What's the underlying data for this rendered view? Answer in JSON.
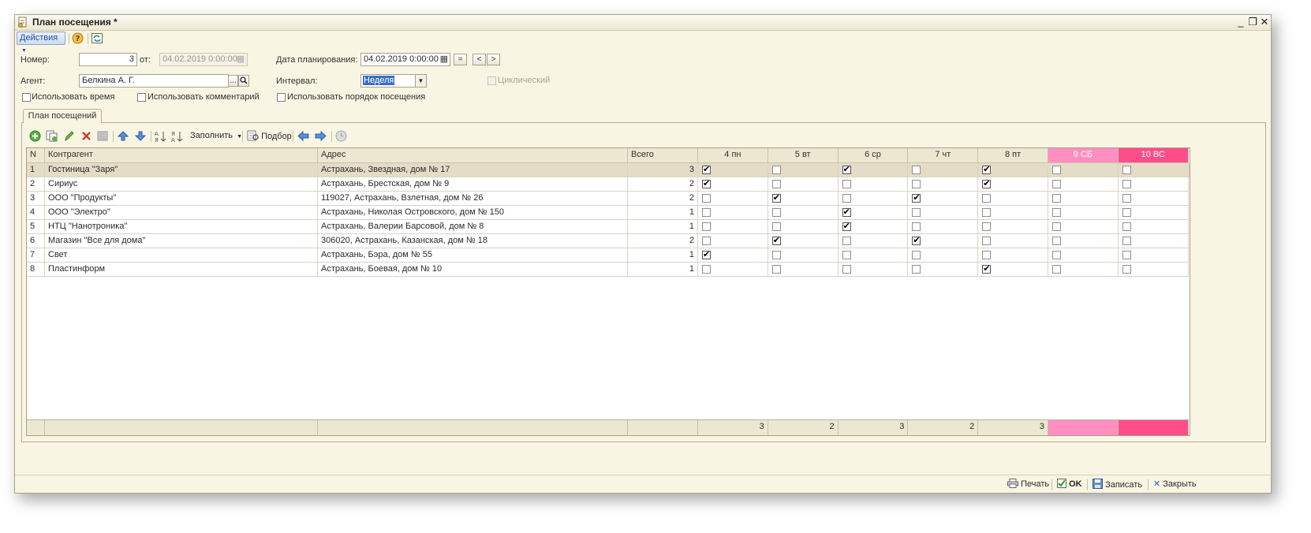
{
  "window": {
    "title": "План посещения *",
    "controls": {
      "minimize": "_",
      "restore": "❐",
      "close": "✕"
    }
  },
  "toolbar": {
    "actions_label": "Действия",
    "help_icon": "help-icon",
    "refresh_icon": "refresh-icon"
  },
  "form": {
    "number_label": "Номер:",
    "number_value": "3",
    "from_label": "от:",
    "from_value": "04.02.2019 0:00:00",
    "plan_date_label": "Дата планирования:",
    "plan_date_value": "04.02.2019 0:00:00",
    "btn_eq": "=",
    "btn_prev": "<",
    "btn_next": ">",
    "agent_label": "Агент:",
    "agent_value": "Белкина А. Г.",
    "agent_select": "...",
    "interval_label": "Интервал:",
    "interval_value": "Неделя",
    "cyclic_label": "Циклический",
    "use_time_label": "Использовать время",
    "use_comment_label": "Использовать комментарий",
    "use_order_label": "Использовать порядок посещения"
  },
  "tab": {
    "label": "План посещений"
  },
  "grid_toolbar": {
    "fill_label": "Заполнить",
    "pick_label": "Подбор"
  },
  "table": {
    "columns": {
      "n": "N",
      "counterparty": "Контрагент",
      "address": "Адрес",
      "total": "Всего",
      "days": [
        "4 пн",
        "5 вт",
        "6 ср",
        "7 чт",
        "8 пт",
        "9 СБ",
        "10 ВС"
      ]
    },
    "rows": [
      {
        "n": "1",
        "name": "Гостиница \"Заря\"",
        "address": "Астрахань, Звездная, дом № 17",
        "total": "3",
        "days": [
          true,
          false,
          true,
          false,
          true,
          false,
          false
        ]
      },
      {
        "n": "2",
        "name": "Сириус",
        "address": "Астрахань, Брестская, дом № 9",
        "total": "2",
        "days": [
          true,
          false,
          false,
          false,
          true,
          false,
          false
        ]
      },
      {
        "n": "3",
        "name": "ООО \"Продукты\"",
        "address": "119027, Астрахань, Взлетная, дом № 26",
        "total": "2",
        "days": [
          false,
          true,
          false,
          true,
          false,
          false,
          false
        ]
      },
      {
        "n": "4",
        "name": "ООО \"Электро\"",
        "address": "Астрахань, Николая Островского, дом № 150",
        "total": "1",
        "days": [
          false,
          false,
          true,
          false,
          false,
          false,
          false
        ]
      },
      {
        "n": "5",
        "name": "НТЦ \"Нанотроника\"",
        "address": "Астрахань, Валерии Барсовой, дом № 8",
        "total": "1",
        "days": [
          false,
          false,
          true,
          false,
          false,
          false,
          false
        ]
      },
      {
        "n": "6",
        "name": "Магазин \"Все для дома\"",
        "address": "306020, Астрахань, Казанская, дом № 18",
        "total": "2",
        "days": [
          false,
          true,
          false,
          true,
          false,
          false,
          false
        ]
      },
      {
        "n": "7",
        "name": "Свет",
        "address": "Астрахань, Бэра, дом № 55",
        "total": "1",
        "days": [
          true,
          false,
          false,
          false,
          false,
          false,
          false
        ]
      },
      {
        "n": "8",
        "name": "Пластинформ",
        "address": "Астрахань, Боевая, дом № 10",
        "total": "1",
        "days": [
          false,
          false,
          false,
          false,
          true,
          false,
          false
        ]
      }
    ],
    "totals": [
      "3",
      "2",
      "3",
      "2",
      "3",
      "",
      ""
    ],
    "selected_row": 0
  },
  "footer": {
    "print_label": "Печать",
    "ok_label": "OK",
    "save_label": "Записать",
    "close_label": "Закрыть"
  },
  "colors": {
    "window_bg": "#f8f5e3",
    "header_bg": "#ece7d1",
    "selected_row_bg": "#e4dcc6",
    "saturday": "#ff8fc0",
    "sunday": "#ff4d8a",
    "interval_highlight": "#3a6fc7"
  }
}
